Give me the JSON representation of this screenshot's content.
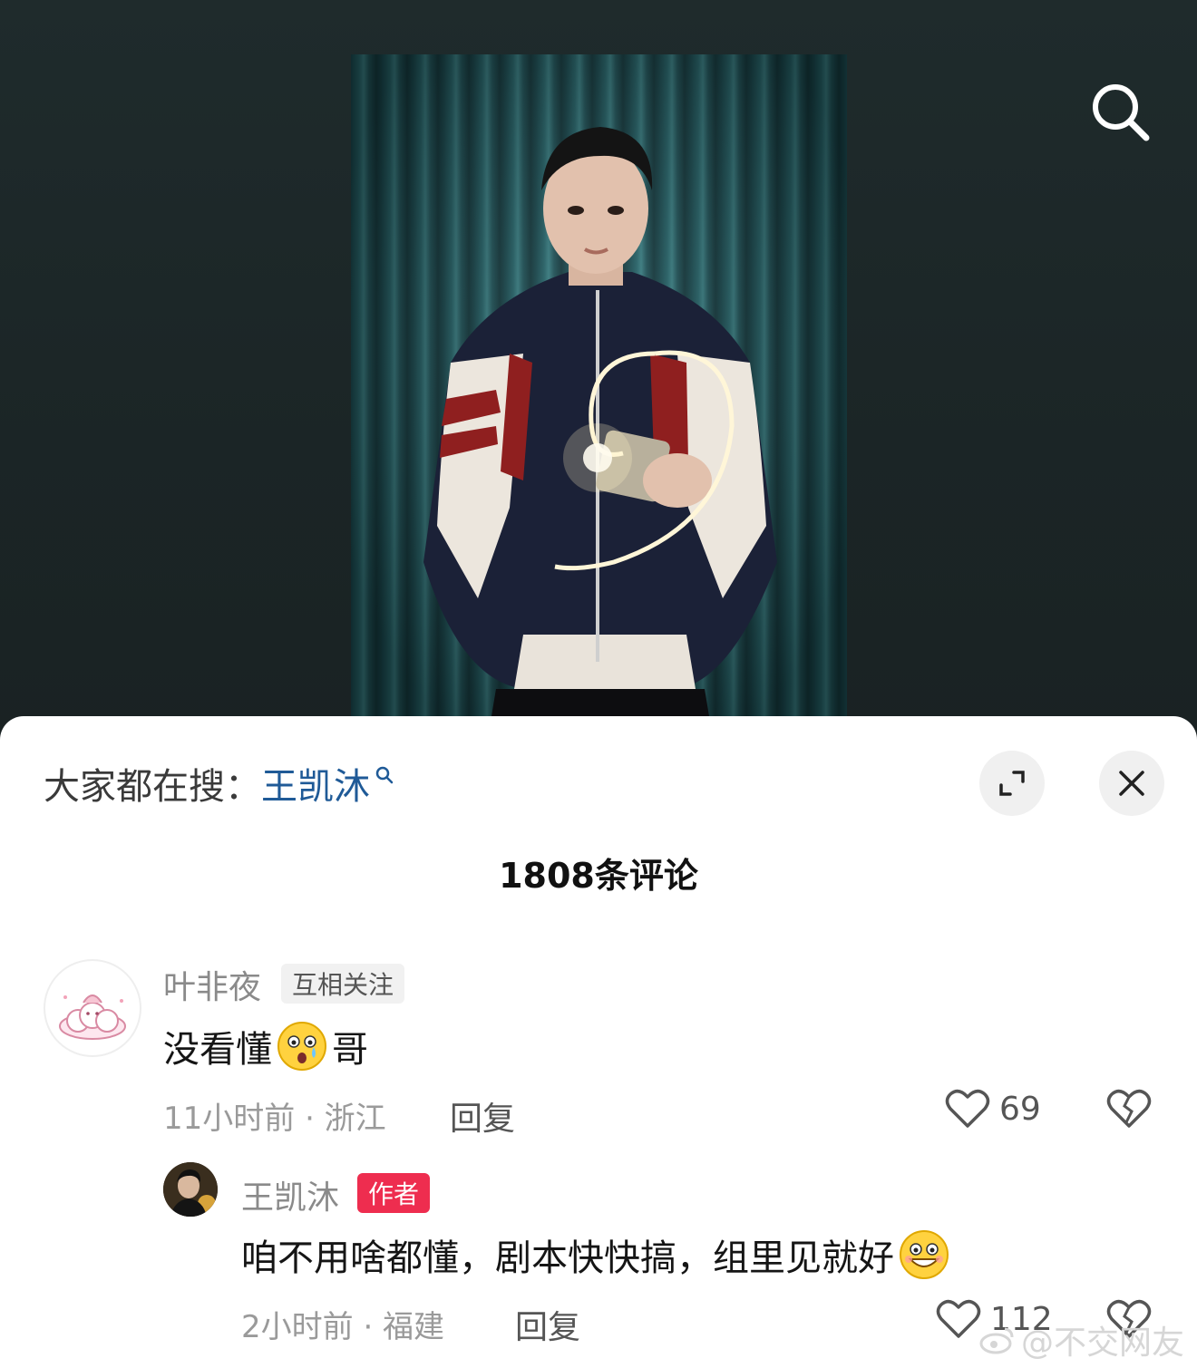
{
  "top": {
    "search_icon": "search-icon"
  },
  "hot_search": {
    "prefix": "大家都在搜：",
    "keyword": "王凯沐",
    "expand_icon": "expand-icon",
    "close_icon": "close-icon"
  },
  "comments_header": {
    "count_label": "1808条评论"
  },
  "comments": [
    {
      "user": "叶非夜",
      "badge": "互相关注",
      "text_before": "没看懂",
      "emoji": "surprised-emoji",
      "text_after": "哥",
      "time_location": "11小时前 · 浙江",
      "reply_label": "回复",
      "likes": "69"
    },
    {
      "user": "王凯沐",
      "badge": "作者",
      "text_before": "咱不用啥都懂，剧本快快搞，组里见就好",
      "emoji": "grin-emoji",
      "text_after": "",
      "time_location": "2小时前 · 福建",
      "reply_label": "回复",
      "likes": "112"
    }
  ],
  "watermark": {
    "text": "@不交网友"
  },
  "colors": {
    "accent_link": "#1f5a97",
    "author_badge": "#ee2d4f"
  }
}
